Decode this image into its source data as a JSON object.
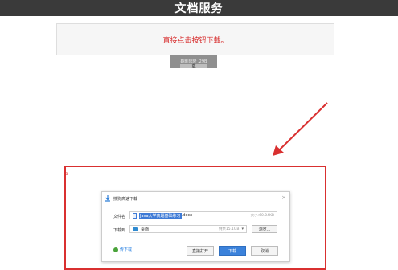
{
  "header": {
    "title": "文档服务"
  },
  "notice": {
    "text": "直接点击按钮下载。"
  },
  "download_button": {
    "label": "翻刺阵隆 .29B",
    "shadow_label": "载"
  },
  "annotation": {
    "frame_mark": "o"
  },
  "dialog": {
    "title": "搜狗高速下载",
    "close": "×",
    "file_label": "文件名",
    "file_name_highlighted": "Java大学真题基础练习",
    "file_name_ext": ".docx",
    "file_size": "大小:60.04KB",
    "dest_label": "下载到",
    "dest_name": "桌面",
    "dest_free": "剩余15.1GB",
    "dest_caret": "▾",
    "browse": "浏览...",
    "phone_link": "传下载",
    "open_button": "直接打开",
    "download_button": "下载",
    "cancel_button": "取消"
  },
  "colors": {
    "header": "#3a3a3a",
    "notice_text": "#d72c2c",
    "highlight": "#d93030",
    "primary": "#3b82db"
  }
}
